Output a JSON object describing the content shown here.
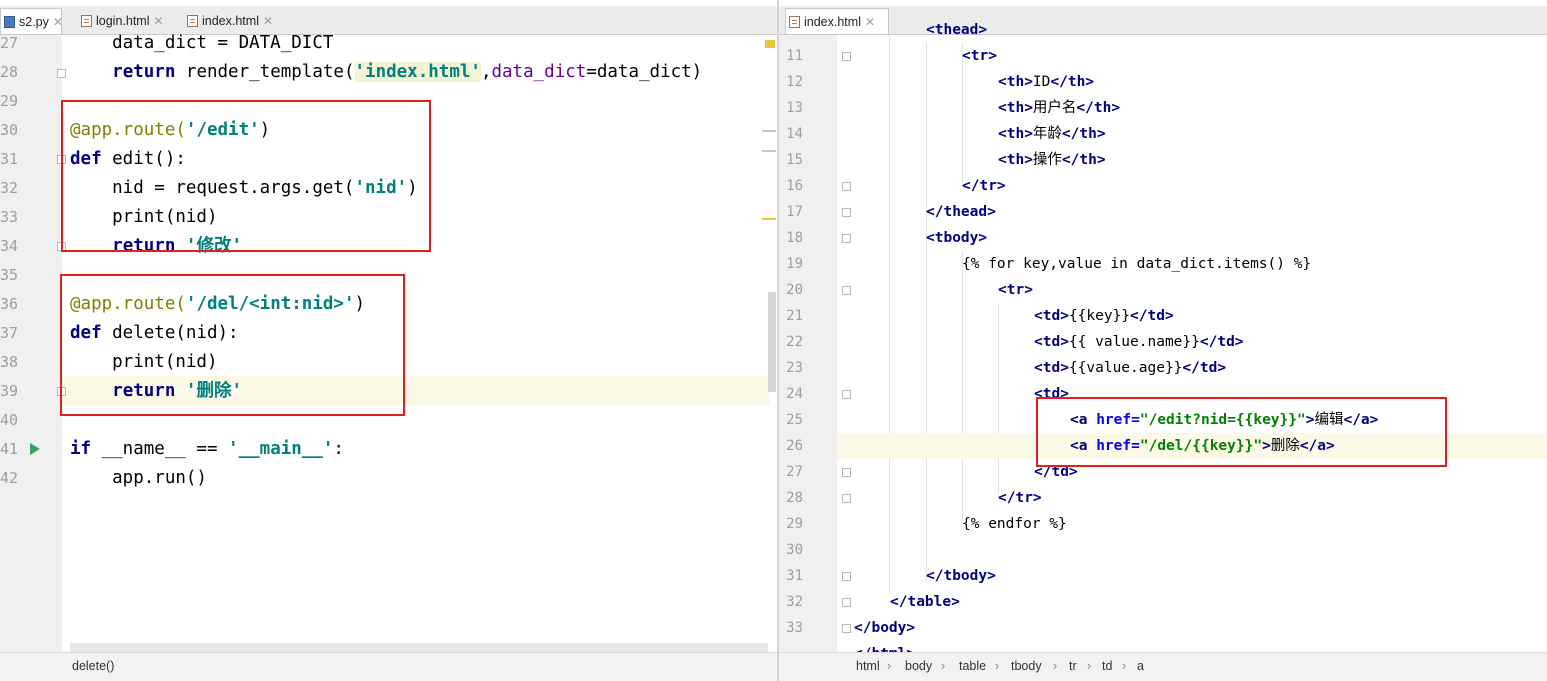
{
  "left_pane": {
    "tabs": [
      {
        "label": "s2.py",
        "icon": "python-file-icon"
      },
      {
        "label": "login.html",
        "icon": "html-file-icon"
      },
      {
        "label": "index.html",
        "icon": "html-file-icon"
      }
    ],
    "line_numbers": [
      "27",
      "28",
      "29",
      "30",
      "31",
      "32",
      "33",
      "34",
      "35",
      "36",
      "37",
      "38",
      "39",
      "40",
      "41",
      "42"
    ],
    "code": {
      "l27": {
        "a": "    data_dict = DATA_DICT"
      },
      "l28": {
        "indent": "    ",
        "kw": "return",
        "a": " render_template(",
        "s": "'index.html'",
        "b": ",",
        "p": "data_dict",
        "c": "=data_dict)"
      },
      "l30": {
        "deco": "@app.route(",
        "s": "'/edit'",
        "c": ")"
      },
      "l31": {
        "kw": "def",
        "c": " edit():"
      },
      "l32": {
        "a": "    nid = request.args.get(",
        "s": "'nid'",
        "c": ")"
      },
      "l33": {
        "a": "    print(nid)"
      },
      "l34": {
        "indent": "    ",
        "kw": "return",
        "sp": " ",
        "s": "'修改'"
      },
      "l36": {
        "deco": "@app.route(",
        "s": "'/del/<int:nid>'",
        "c": ")"
      },
      "l37": {
        "kw": "def",
        "c": " delete(nid):"
      },
      "l38": {
        "a": "    print(nid)"
      },
      "l39": {
        "indent": "    ",
        "kw": "return",
        "sp": " ",
        "s": "'删除'"
      },
      "l41": {
        "kw": "if",
        "a": " __name__ == ",
        "s": "'__main__'",
        "c": ":"
      },
      "l42": {
        "a": "    app.run()"
      }
    },
    "status_text": "delete()"
  },
  "right_pane": {
    "tab": {
      "label": "index.html",
      "icon": "html-file-icon"
    },
    "line_numbers": [
      "11",
      "12",
      "13",
      "14",
      "15",
      "16",
      "17",
      "18",
      "19",
      "20",
      "21",
      "22",
      "23",
      "24",
      "25",
      "26",
      "27",
      "28",
      "29",
      "30",
      "31",
      "32",
      "33"
    ],
    "code": {
      "l10": {
        "tag": "<thead>"
      },
      "l11": {
        "tag": "<tr>"
      },
      "l12": {
        "o": "<th>",
        "t": "ID",
        "c": "</th>"
      },
      "l13": {
        "o": "<th>",
        "t": "用户名",
        "c": "</th>"
      },
      "l14": {
        "o": "<th>",
        "t": "年龄",
        "c": "</th>"
      },
      "l15": {
        "o": "<th>",
        "t": "操作",
        "c": "</th>"
      },
      "l16": {
        "tag": "</tr>"
      },
      "l17": {
        "tag": "</thead>"
      },
      "l18": {
        "tag": "<tbody>"
      },
      "l19": {
        "t": "{% for key,value in data_dict.items() %}"
      },
      "l20": {
        "tag": "<tr>"
      },
      "l21": {
        "o": "<td>",
        "t": "{{key}}",
        "c": "</td>"
      },
      "l22": {
        "o": "<td>",
        "t": "{{ value.name}}",
        "c": "</td>"
      },
      "l23": {
        "o": "<td>",
        "t": "{{value.age}}",
        "c": "</td>"
      },
      "l24": {
        "tag": "<td>"
      },
      "l25": {
        "o": "<a",
        "attr": " href=",
        "v": "\"/edit?nid={{key}}\"",
        "gt": ">",
        "t": "编辑",
        "c": "</a>"
      },
      "l26": {
        "o": "<a",
        "attr": " href=",
        "v": "\"/del/{{key}}\"",
        "gt": ">",
        "t": "删除",
        "c": "</a>"
      },
      "l27": {
        "tag": "</td>"
      },
      "l28": {
        "tag": "</tr>"
      },
      "l29": {
        "t": "{% endfor %}"
      },
      "l31": {
        "tag": "</tbody>"
      },
      "l32": {
        "tag": "</table>"
      },
      "l33": {
        "tag": "</body>"
      },
      "l34": {
        "tag": "</html>"
      }
    },
    "breadcrumbs": [
      "html",
      "body",
      "table",
      "tbody",
      "tr",
      "td",
      "a"
    ]
  },
  "colors": {
    "highlight_box": "#e02020",
    "current_line": "#fcfae6",
    "keyword": "#000080",
    "string": "#008080"
  }
}
